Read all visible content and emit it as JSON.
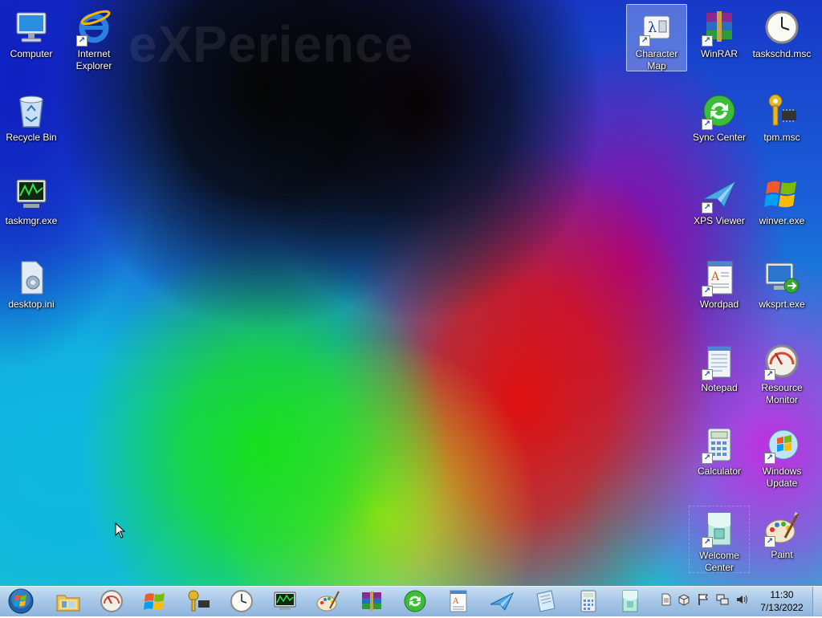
{
  "desktop": {
    "watermark": "eXPerience",
    "left_icons": [
      {
        "label": "Computer",
        "icon": "computer-icon"
      },
      {
        "label": "Internet Explorer",
        "icon": "internet-explorer-icon"
      },
      {
        "label": "Recycle Bin",
        "icon": "recycle-bin-icon"
      },
      {
        "label": "taskmgr.exe",
        "icon": "taskmgr-icon"
      },
      {
        "label": "desktop.ini",
        "icon": "ini-file-icon"
      }
    ],
    "right_icons": [
      {
        "label": "Character Map",
        "icon": "character-map-icon",
        "selected": true
      },
      {
        "label": "WinRAR",
        "icon": "winrar-icon"
      },
      {
        "label": "taskschd.msc",
        "icon": "clock-icon"
      },
      {
        "label": "Sync Center",
        "icon": "sync-center-icon"
      },
      {
        "label": "tpm.msc",
        "icon": "key-chip-icon"
      },
      {
        "label": "XPS Viewer",
        "icon": "xps-viewer-icon"
      },
      {
        "label": "winver.exe",
        "icon": "windows-flag-icon"
      },
      {
        "label": "Wordpad",
        "icon": "wordpad-icon"
      },
      {
        "label": "wksprt.exe",
        "icon": "remote-desktop-icon"
      },
      {
        "label": "Notepad",
        "icon": "notepad-icon"
      },
      {
        "label": "Resource Monitor",
        "icon": "gauge-icon"
      },
      {
        "label": "Calculator",
        "icon": "calculator-icon"
      },
      {
        "label": "Windows Update",
        "icon": "windows-update-icon"
      },
      {
        "label": "Welcome Center",
        "icon": "welcome-center-icon"
      },
      {
        "label": "Paint",
        "icon": "paint-icon"
      }
    ]
  },
  "taskbar": {
    "start_button": "start-orb-icon",
    "pinned": [
      "explorer-folder-icon",
      "resource-monitor-icon",
      "windows-flag-icon",
      "key-chip-icon",
      "clock-icon",
      "taskmgr-icon",
      "paint-icon",
      "winrar-icon",
      "sync-center-icon",
      "wordpad-icon",
      "xps-viewer-icon",
      "notepad-icon",
      "calculator-icon",
      "welcome-center-icon"
    ],
    "tray_icons": [
      "document-icon",
      "package-icon",
      "flag-icon",
      "network-icon",
      "speaker-icon"
    ],
    "clock": {
      "time": "11:30",
      "date": "7/13/2022"
    }
  },
  "colors": {
    "taskbar": "#a9c8e8",
    "selection": "#c8dcff",
    "label_text": "#ffffff"
  }
}
